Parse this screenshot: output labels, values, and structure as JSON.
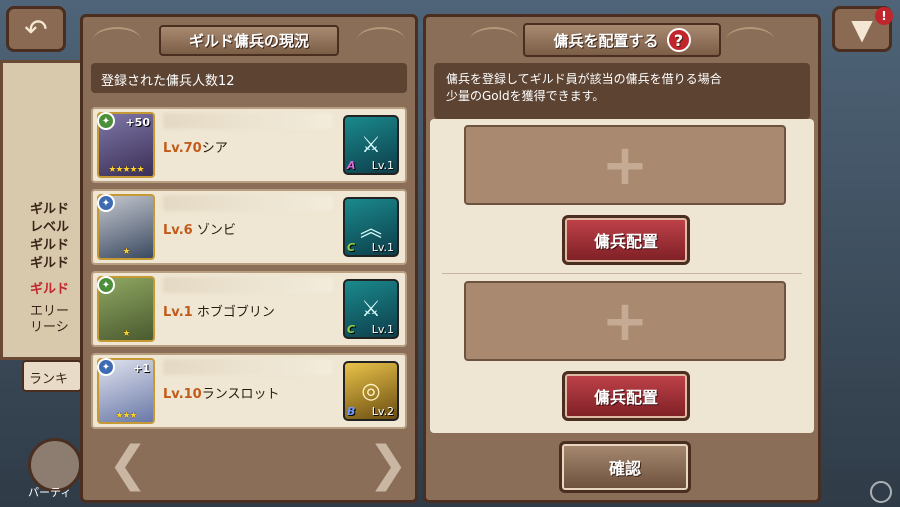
{
  "background": {
    "menu_lines": [
      "ギルド",
      "レベル",
      "ギルド",
      "ギルド"
    ],
    "highlight_line": "ギルド",
    "elite_lines": [
      "エリー",
      "リーシ"
    ],
    "ranking_label": "ランキ",
    "party_label": "パーティ"
  },
  "left_panel": {
    "title": "ギルド傭兵の現況",
    "count_label": "登録された傭兵人数12",
    "mercenaries": [
      {
        "level": "Lv.70",
        "name": "シア",
        "plus": "+50",
        "stars": "★★★★★",
        "skill_rank": "A",
        "skill_level": "Lv.1"
      },
      {
        "level": "Lv.6",
        "name": " ゾンビ",
        "plus": "",
        "stars": "★",
        "skill_rank": "C",
        "skill_level": "Lv.1"
      },
      {
        "level": "Lv.1",
        "name": " ホブゴブリン",
        "plus": "",
        "stars": "★",
        "skill_rank": "C",
        "skill_level": "Lv.1"
      },
      {
        "level": "Lv.10",
        "name": "ランスロット",
        "plus": "+1",
        "stars": "★★★",
        "skill_rank": "B",
        "skill_level": "Lv.2"
      }
    ],
    "prev_arrow": "❮",
    "next_arrow": "❯"
  },
  "right_panel": {
    "title": "傭兵を配置する",
    "help_icon": "?",
    "description_line1": "傭兵を登録してギルド員が該当の傭兵を借りる場合",
    "description_line2": "少量のGoldを獲得できます。",
    "slot_icon": "+",
    "assign_button_1": "傭兵配置",
    "assign_button_2": "傭兵配置",
    "confirm_button": "確認"
  },
  "top": {
    "back_icon": "↶",
    "menu_icon": "▼",
    "badge": "!"
  }
}
